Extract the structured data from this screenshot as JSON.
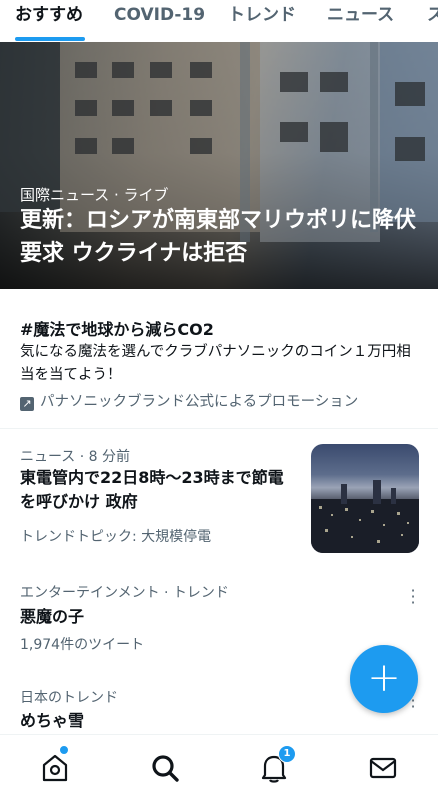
{
  "tabs": [
    {
      "label": "おすすめ",
      "active": true
    },
    {
      "label": "COVID-19"
    },
    {
      "label": "トレンド"
    },
    {
      "label": "ニュース"
    },
    {
      "label": "ス"
    }
  ],
  "hero": {
    "meta": "国際ニュース · ライブ",
    "title": "更新：ロシアが南東部マリウポリに降伏要求 ウクライナは拒否"
  },
  "promo": {
    "title": "#魔法で地球から減らCO2",
    "description": "気になる魔法を選んでクラブパナソニックのコイン１万円相当を当てよう！",
    "promoted_by": "パナソニックブランド公式によるプロモーション"
  },
  "news_item": {
    "meta": "ニュース · 8 分前",
    "title": "東電管内で22日8時〜23時まで節電を呼びかけ 政府",
    "topic": "トレンドトピック: 大規模停電"
  },
  "trend_1": {
    "meta": "エンターテインメント · トレンド",
    "title": "悪魔の子",
    "count": "1,974件のツイート"
  },
  "trend_2": {
    "meta": "日本のトレンド",
    "title": "めちゃ雪"
  },
  "fab_label": "+",
  "bottom_nav": {
    "items": [
      "home-icon",
      "search-icon",
      "bell-icon",
      "mail-icon"
    ],
    "notification_count": "1"
  },
  "colors": {
    "accent": "#1d9bf0",
    "secondary_text": "#536471"
  }
}
